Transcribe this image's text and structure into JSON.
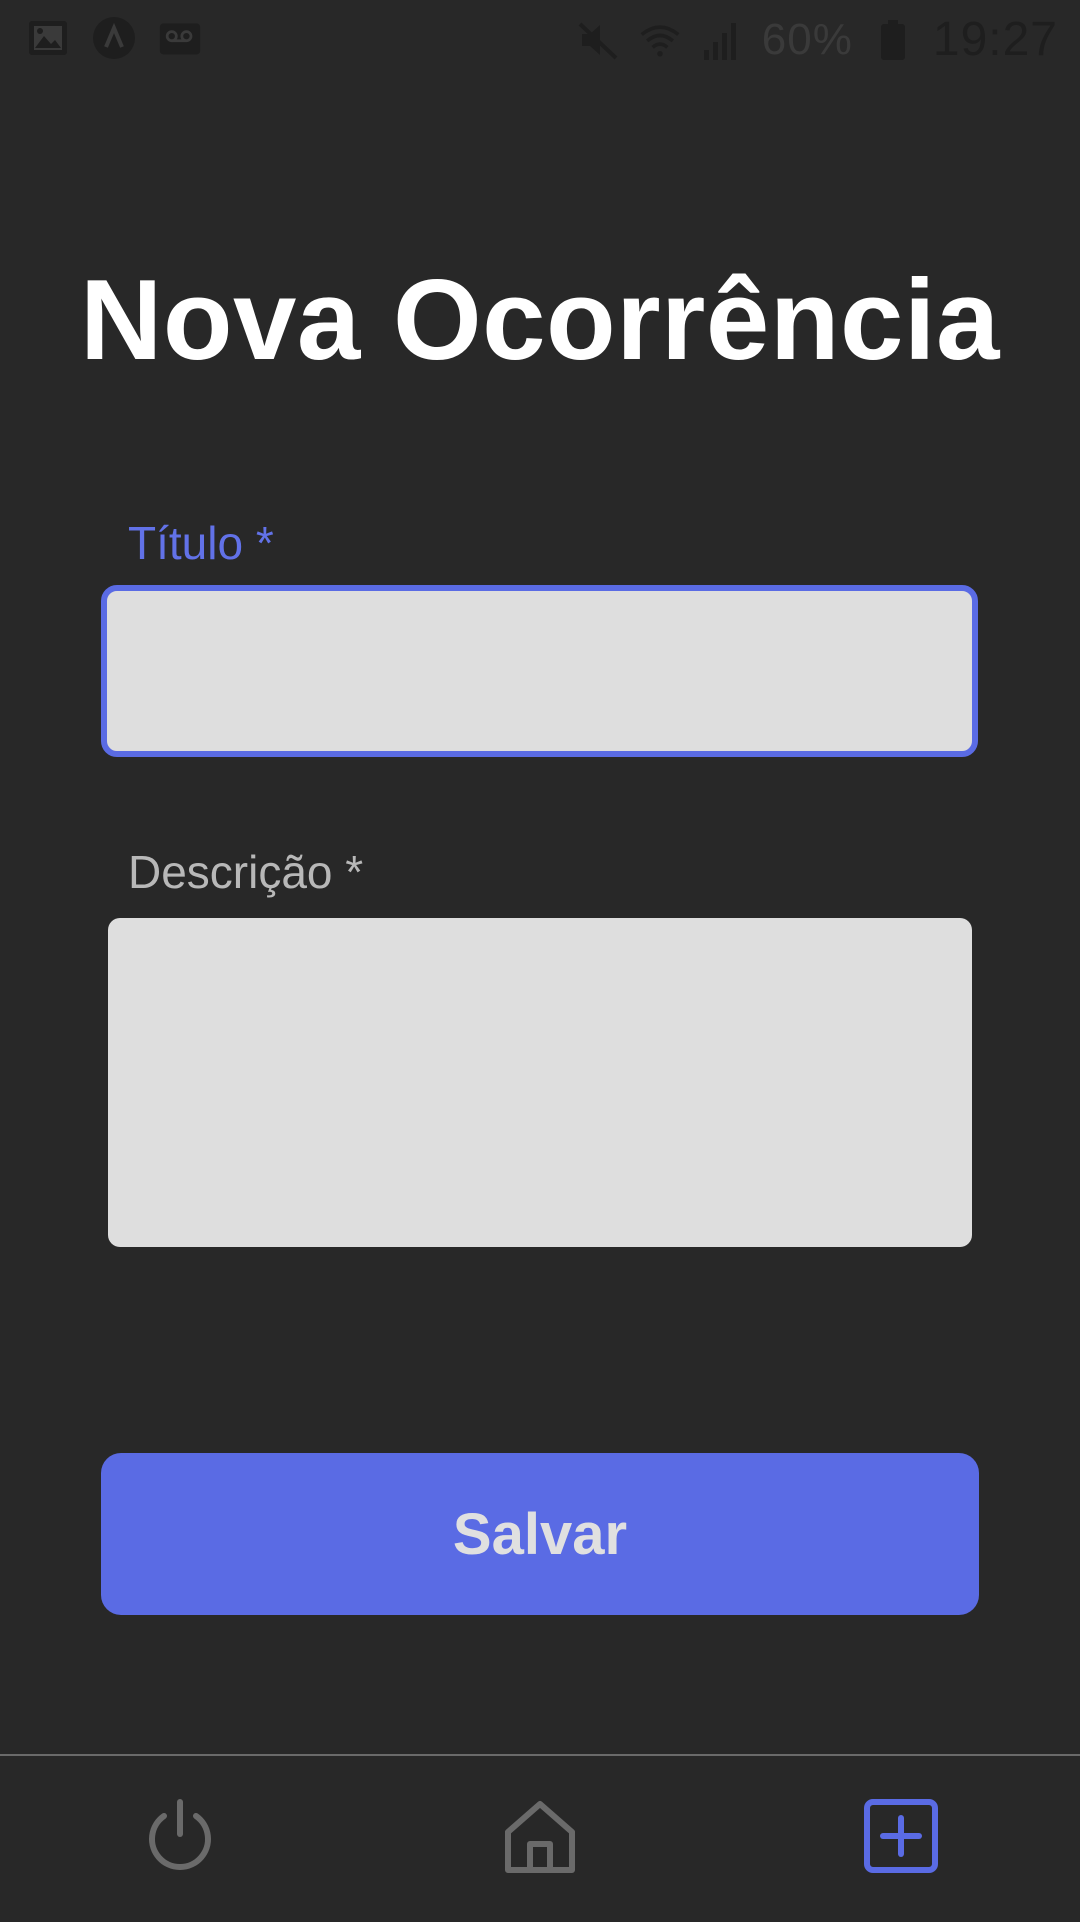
{
  "status_bar": {
    "time": "19:27",
    "battery": "60%",
    "icons_left": [
      "image-icon",
      "app-icon",
      "voicemail-icon"
    ],
    "icons_right": [
      "mute-icon",
      "wifi-icon",
      "signal-icon",
      "battery-icon"
    ]
  },
  "page": {
    "title": "Nova Ocorrência"
  },
  "form": {
    "title_label": "Título *",
    "title_value": "",
    "description_label": "Descrição *",
    "description_value": "",
    "save_label": "Salvar"
  },
  "bottom_nav": {
    "items": [
      {
        "icon": "power-icon",
        "active": false
      },
      {
        "icon": "home-icon",
        "active": false
      },
      {
        "icon": "add-square-icon",
        "active": true
      }
    ]
  },
  "colors": {
    "background": "#282828",
    "accent": "#5a6be4",
    "input_bg": "#dedede",
    "inactive_icon": "#6a6a6a"
  }
}
